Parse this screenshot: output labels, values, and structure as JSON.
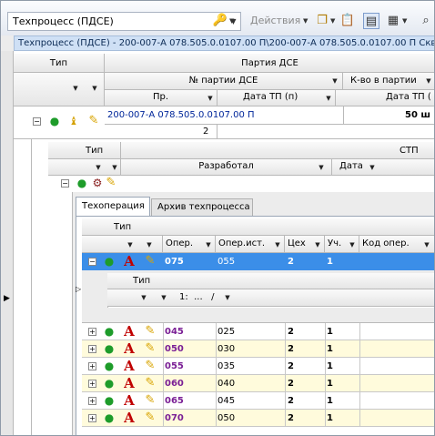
{
  "toolbar": {
    "combo_value": "Техпроцесс (ПДСЕ)",
    "actions_label": "Действия",
    "icons": [
      "key-icon",
      "copy-icon",
      "clipboard-icon",
      "view-icon",
      "layout-icon",
      "search-icon"
    ]
  },
  "path_bar": "Техпроцесс (ПДСЕ) - 200-007-А 078.505.0.0107.00 П\\200-007-А 078.505.0.0107.00 П Скв",
  "level1": {
    "header": {
      "type": "Тип",
      "party": "Партия ДСЕ",
      "party_no": "№ партии ДСЕ",
      "qty": "К-во в партии",
      "pr": "Пр.",
      "date_tp_n": "Дата ТП (п)",
      "date_tp": "Дата ТП ("
    },
    "row": {
      "party_no": "200-007-А 078.505.0.0107.00 П",
      "qty": "50 ш",
      "pr": "2"
    }
  },
  "level2": {
    "header": {
      "type": "Тип",
      "stp": "СТП",
      "developed": "Разработал",
      "date": "Дата"
    },
    "tabs": [
      {
        "label": "Техоперация"
      },
      {
        "label": "Архив техпроцесса"
      }
    ]
  },
  "ops": {
    "header": {
      "type": "Тип",
      "oper": "Опер.",
      "src": "Опер.ист.",
      "shop": "Цех",
      "sect": "Уч.",
      "code": "Код опер."
    },
    "selected": {
      "oper": "075",
      "src": "055",
      "shop": "2",
      "sect": "1"
    },
    "sub": {
      "type": "Тип",
      "value": "1:  ...   /"
    },
    "rows": [
      {
        "oper": "045",
        "src": "025",
        "shop": "2",
        "sect": "1"
      },
      {
        "oper": "050",
        "src": "030",
        "shop": "2",
        "sect": "1"
      },
      {
        "oper": "055",
        "src": "035",
        "shop": "2",
        "sect": "1"
      },
      {
        "oper": "060",
        "src": "040",
        "shop": "2",
        "sect": "1"
      },
      {
        "oper": "065",
        "src": "045",
        "shop": "2",
        "sect": "1"
      },
      {
        "oper": "070",
        "src": "050",
        "shop": "2",
        "sect": "1"
      }
    ]
  },
  "colors": {
    "selected": "#3b8ee8",
    "alt_row": "#fffbdc",
    "path_bg": "#cfe0f5"
  }
}
